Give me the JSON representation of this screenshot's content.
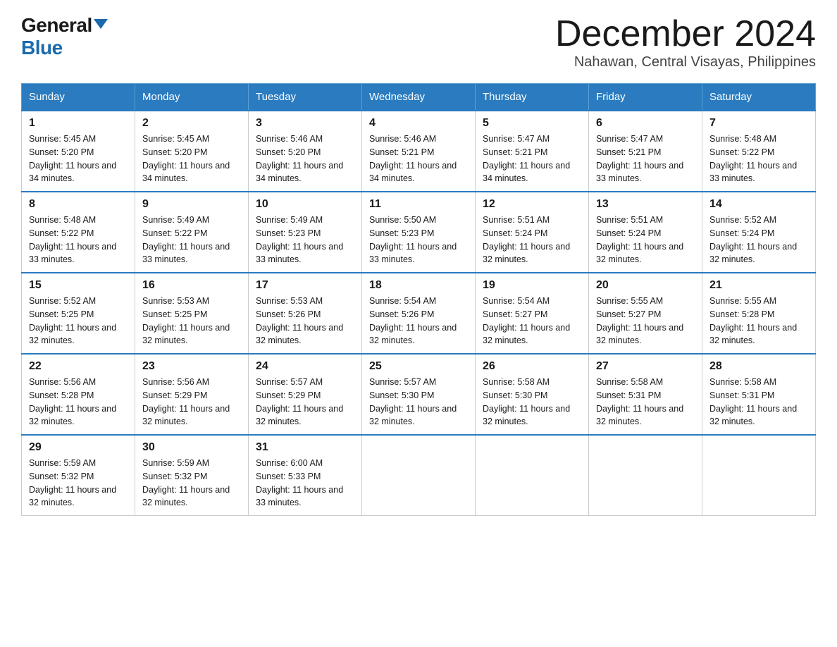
{
  "logo": {
    "general": "General",
    "blue": "Blue"
  },
  "title": "December 2024",
  "subtitle": "Nahawan, Central Visayas, Philippines",
  "weekdays": [
    "Sunday",
    "Monday",
    "Tuesday",
    "Wednesday",
    "Thursday",
    "Friday",
    "Saturday"
  ],
  "weeks": [
    [
      {
        "day": "1",
        "sunrise": "5:45 AM",
        "sunset": "5:20 PM",
        "daylight": "11 hours and 34 minutes."
      },
      {
        "day": "2",
        "sunrise": "5:45 AM",
        "sunset": "5:20 PM",
        "daylight": "11 hours and 34 minutes."
      },
      {
        "day": "3",
        "sunrise": "5:46 AM",
        "sunset": "5:20 PM",
        "daylight": "11 hours and 34 minutes."
      },
      {
        "day": "4",
        "sunrise": "5:46 AM",
        "sunset": "5:21 PM",
        "daylight": "11 hours and 34 minutes."
      },
      {
        "day": "5",
        "sunrise": "5:47 AM",
        "sunset": "5:21 PM",
        "daylight": "11 hours and 34 minutes."
      },
      {
        "day": "6",
        "sunrise": "5:47 AM",
        "sunset": "5:21 PM",
        "daylight": "11 hours and 33 minutes."
      },
      {
        "day": "7",
        "sunrise": "5:48 AM",
        "sunset": "5:22 PM",
        "daylight": "11 hours and 33 minutes."
      }
    ],
    [
      {
        "day": "8",
        "sunrise": "5:48 AM",
        "sunset": "5:22 PM",
        "daylight": "11 hours and 33 minutes."
      },
      {
        "day": "9",
        "sunrise": "5:49 AM",
        "sunset": "5:22 PM",
        "daylight": "11 hours and 33 minutes."
      },
      {
        "day": "10",
        "sunrise": "5:49 AM",
        "sunset": "5:23 PM",
        "daylight": "11 hours and 33 minutes."
      },
      {
        "day": "11",
        "sunrise": "5:50 AM",
        "sunset": "5:23 PM",
        "daylight": "11 hours and 33 minutes."
      },
      {
        "day": "12",
        "sunrise": "5:51 AM",
        "sunset": "5:24 PM",
        "daylight": "11 hours and 32 minutes."
      },
      {
        "day": "13",
        "sunrise": "5:51 AM",
        "sunset": "5:24 PM",
        "daylight": "11 hours and 32 minutes."
      },
      {
        "day": "14",
        "sunrise": "5:52 AM",
        "sunset": "5:24 PM",
        "daylight": "11 hours and 32 minutes."
      }
    ],
    [
      {
        "day": "15",
        "sunrise": "5:52 AM",
        "sunset": "5:25 PM",
        "daylight": "11 hours and 32 minutes."
      },
      {
        "day": "16",
        "sunrise": "5:53 AM",
        "sunset": "5:25 PM",
        "daylight": "11 hours and 32 minutes."
      },
      {
        "day": "17",
        "sunrise": "5:53 AM",
        "sunset": "5:26 PM",
        "daylight": "11 hours and 32 minutes."
      },
      {
        "day": "18",
        "sunrise": "5:54 AM",
        "sunset": "5:26 PM",
        "daylight": "11 hours and 32 minutes."
      },
      {
        "day": "19",
        "sunrise": "5:54 AM",
        "sunset": "5:27 PM",
        "daylight": "11 hours and 32 minutes."
      },
      {
        "day": "20",
        "sunrise": "5:55 AM",
        "sunset": "5:27 PM",
        "daylight": "11 hours and 32 minutes."
      },
      {
        "day": "21",
        "sunrise": "5:55 AM",
        "sunset": "5:28 PM",
        "daylight": "11 hours and 32 minutes."
      }
    ],
    [
      {
        "day": "22",
        "sunrise": "5:56 AM",
        "sunset": "5:28 PM",
        "daylight": "11 hours and 32 minutes."
      },
      {
        "day": "23",
        "sunrise": "5:56 AM",
        "sunset": "5:29 PM",
        "daylight": "11 hours and 32 minutes."
      },
      {
        "day": "24",
        "sunrise": "5:57 AM",
        "sunset": "5:29 PM",
        "daylight": "11 hours and 32 minutes."
      },
      {
        "day": "25",
        "sunrise": "5:57 AM",
        "sunset": "5:30 PM",
        "daylight": "11 hours and 32 minutes."
      },
      {
        "day": "26",
        "sunrise": "5:58 AM",
        "sunset": "5:30 PM",
        "daylight": "11 hours and 32 minutes."
      },
      {
        "day": "27",
        "sunrise": "5:58 AM",
        "sunset": "5:31 PM",
        "daylight": "11 hours and 32 minutes."
      },
      {
        "day": "28",
        "sunrise": "5:58 AM",
        "sunset": "5:31 PM",
        "daylight": "11 hours and 32 minutes."
      }
    ],
    [
      {
        "day": "29",
        "sunrise": "5:59 AM",
        "sunset": "5:32 PM",
        "daylight": "11 hours and 32 minutes."
      },
      {
        "day": "30",
        "sunrise": "5:59 AM",
        "sunset": "5:32 PM",
        "daylight": "11 hours and 32 minutes."
      },
      {
        "day": "31",
        "sunrise": "6:00 AM",
        "sunset": "5:33 PM",
        "daylight": "11 hours and 33 minutes."
      },
      null,
      null,
      null,
      null
    ]
  ]
}
